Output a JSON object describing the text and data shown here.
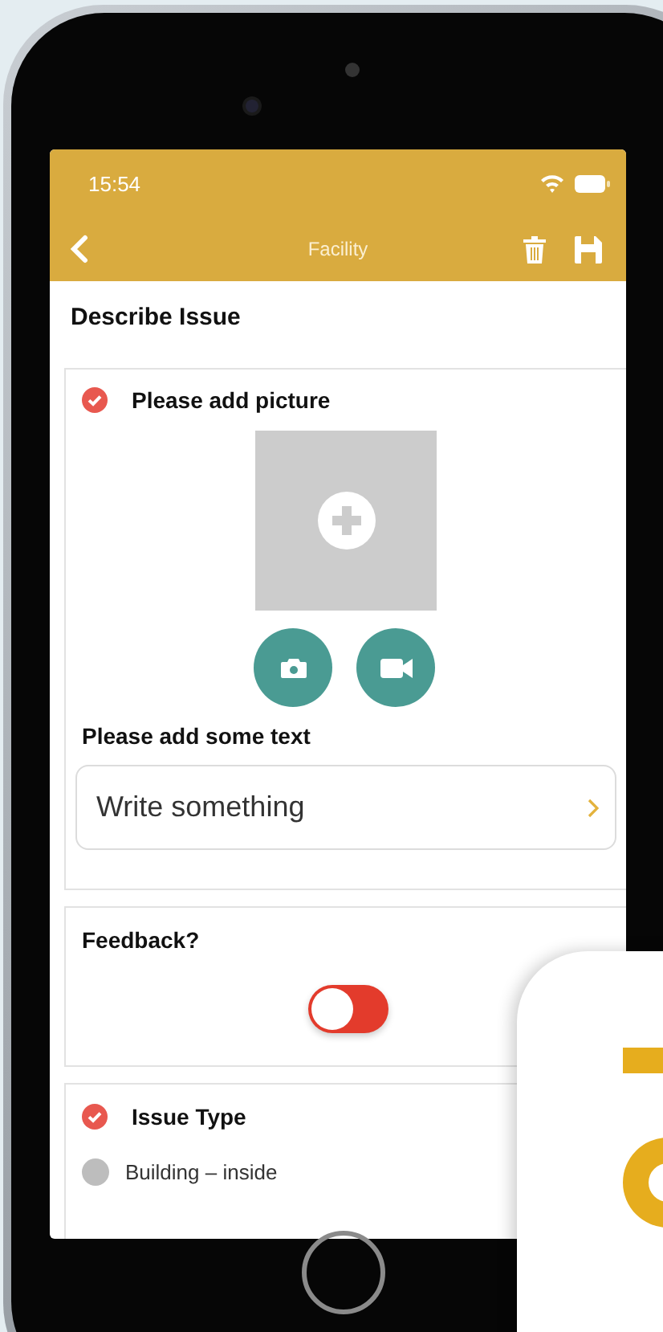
{
  "status_bar": {
    "time": "15:54"
  },
  "nav_bar": {
    "title": "Facility"
  },
  "page_title": "Describe Issue",
  "picture_section": {
    "title": "Please add picture",
    "checked": true,
    "text_label": "Please add some text",
    "text_field": {
      "placeholder": "Write something"
    }
  },
  "feedback_section": {
    "title": "Feedback?",
    "toggle": {
      "on": false
    }
  },
  "issue_type_section": {
    "title": "Issue Type",
    "checked": true,
    "options": [
      {
        "label": "Building – inside",
        "selected": false
      }
    ]
  }
}
